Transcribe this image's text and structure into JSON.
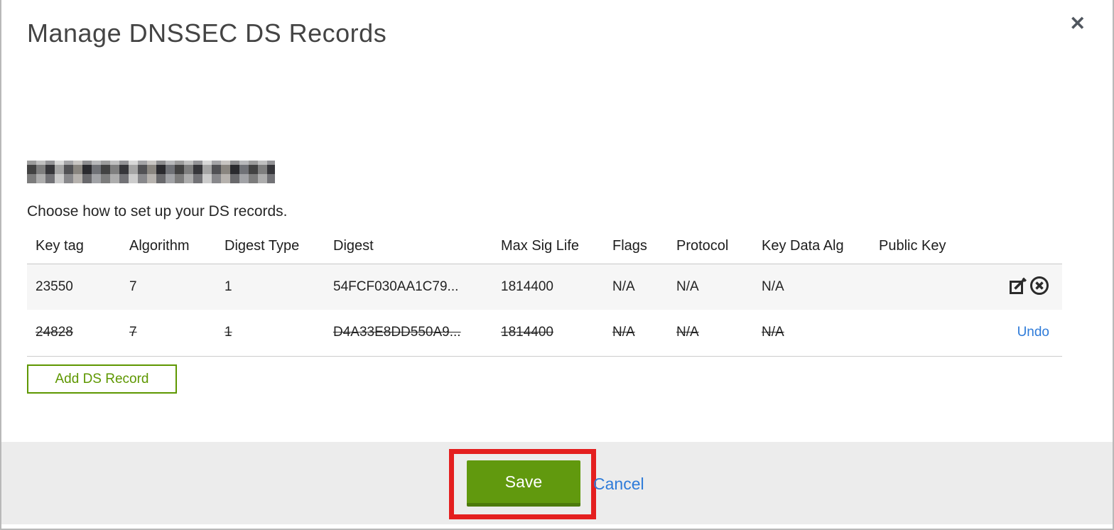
{
  "dialog": {
    "title": "Manage DNSSEC DS Records",
    "close_icon": "✕",
    "domain_redacted": true,
    "instruction": "Choose how to set up your DS records.",
    "add_button_label": "Add DS Record",
    "save_label": "Save",
    "cancel_label": "Cancel",
    "undo_label": "Undo"
  },
  "table": {
    "headers": [
      "Key tag",
      "Algorithm",
      "Digest Type",
      "Digest",
      "Max Sig Life",
      "Flags",
      "Protocol",
      "Key Data Alg",
      "Public Key"
    ],
    "rows": [
      {
        "key_tag": "23550",
        "algorithm": "7",
        "digest_type": "1",
        "digest": "54FCF030AA1C79...",
        "max_sig_life": "1814400",
        "flags": "N/A",
        "protocol": "N/A",
        "key_data_alg": "N/A",
        "public_key": "",
        "state": "current"
      },
      {
        "key_tag": "24828",
        "algorithm": "7",
        "digest_type": "1",
        "digest": "D4A33E8DD550A9...",
        "max_sig_life": "1814400",
        "flags": "N/A",
        "protocol": "N/A",
        "key_data_alg": "N/A",
        "public_key": "",
        "state": "marked-for-deletion"
      }
    ],
    "row_icons": [
      "edit-icon",
      "delete-icon"
    ]
  },
  "colors": {
    "accent_green": "#5e9700",
    "save_button_green": "#61990e",
    "link_blue": "#2e7bd9",
    "annotation_red": "#e41f1f",
    "footer_gray": "#ececec"
  }
}
